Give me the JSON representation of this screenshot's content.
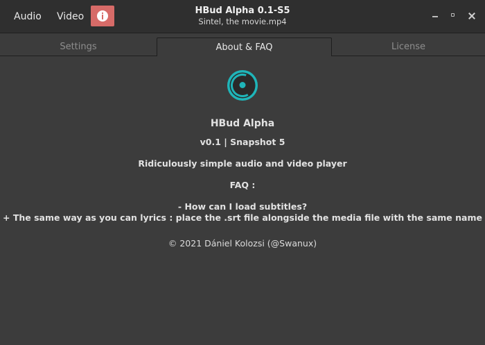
{
  "header": {
    "audio_label": "Audio",
    "video_label": "Video",
    "info_icon": "info-icon",
    "title": "HBud Alpha 0.1-S5",
    "subtitle": "Sintel, the movie.mp4",
    "info_button_color": "#d76b68"
  },
  "tabs": [
    {
      "label": "Settings",
      "active": false
    },
    {
      "label": "About & FAQ",
      "active": true
    },
    {
      "label": "License",
      "active": false
    }
  ],
  "about": {
    "logo_icon": "hbud-logo-icon",
    "logo_color": "#1fb5b9",
    "app_name": "HBud Alpha",
    "version": "v0.1 | Snapshot 5",
    "description": "Ridiculously simple audio and video player",
    "faq_title": "FAQ :",
    "faq_question": "- How can I load subtitles?",
    "faq_answer": "+ The same way as you can lyrics : place the .srt file alongside the media file with the same name",
    "copyright": "© 2021 Dániel Kolozsi (@Swanux)"
  }
}
